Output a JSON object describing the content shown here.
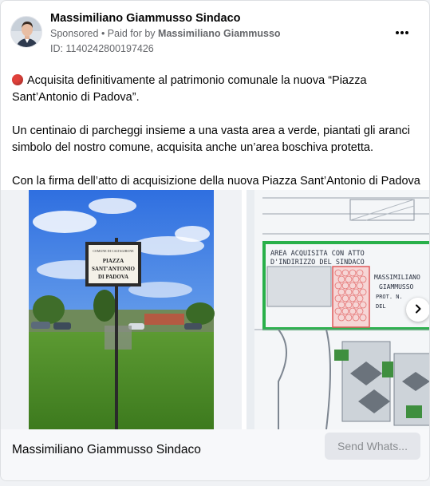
{
  "post": {
    "author": "Massimiliano Giammusso Sindaco",
    "sponsored_label": "Sponsored",
    "separator": " • ",
    "paid_for_prefix": "Paid for by ",
    "paid_for_name": "Massimiliano Giammusso",
    "ad_id": "ID: 1140242800197426",
    "more_icon": "more-horizontal-icon"
  },
  "body": {
    "paragraph1": "Acquisita definitivamente al patrimonio comunale la nuova “Piazza Sant’Antonio di Padova”.",
    "paragraph2": "Un centinaio di parcheggi insieme a una vasta area a verde, piantati gli aranci simbolo del nostro comune, acquisita anche un’area boschiva protetta.",
    "paragraph3": "Con la firma dell’atto di acquisizione della nuova Piazza Sant’Antonio di Padova, l..."
  },
  "carousel": {
    "slide1": {
      "sign_line1": "COMUNE DI CALTAGIRONE",
      "sign_line2": "PIAZZA",
      "sign_line3": "SANT'ANTONIO",
      "sign_line4": "DI PADOVA"
    },
    "slide2": {
      "handwriting_line1": "AREA ACQUISITA CON ATTO",
      "handwriting_line2": "D'INDIRIZZO DEL SINDACO",
      "handwriting_line3": "MASSIMILIANO",
      "handwriting_line4": "GIAMMUSSO",
      "handwriting_line5": "PROT. N.",
      "handwriting_line6": "DEL"
    },
    "next_icon": "chevron-right-icon"
  },
  "footer": {
    "page_name": "Massimiliano Giammusso Sindaco",
    "cta_label": "Send Whats..."
  },
  "colors": {
    "accent_red": "#e0413b",
    "cta_bg": "#e4e6eb",
    "cta_text": "#8a8d91",
    "meta_text": "#65676b"
  }
}
